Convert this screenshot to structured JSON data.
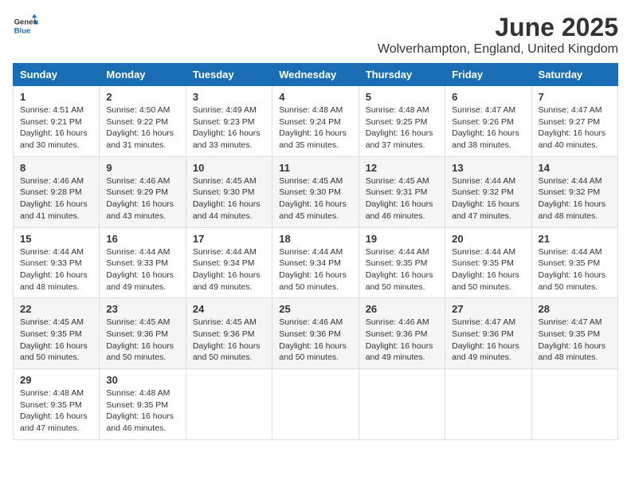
{
  "logo": {
    "general": "General",
    "blue": "Blue"
  },
  "header": {
    "month": "June 2025",
    "location": "Wolverhampton, England, United Kingdom"
  },
  "weekdays": [
    "Sunday",
    "Monday",
    "Tuesday",
    "Wednesday",
    "Thursday",
    "Friday",
    "Saturday"
  ],
  "weeks": [
    [
      {
        "day": "1",
        "sunrise": "4:51 AM",
        "sunset": "9:21 PM",
        "daylight": "16 hours and 30 minutes."
      },
      {
        "day": "2",
        "sunrise": "4:50 AM",
        "sunset": "9:22 PM",
        "daylight": "16 hours and 31 minutes."
      },
      {
        "day": "3",
        "sunrise": "4:49 AM",
        "sunset": "9:23 PM",
        "daylight": "16 hours and 33 minutes."
      },
      {
        "day": "4",
        "sunrise": "4:48 AM",
        "sunset": "9:24 PM",
        "daylight": "16 hours and 35 minutes."
      },
      {
        "day": "5",
        "sunrise": "4:48 AM",
        "sunset": "9:25 PM",
        "daylight": "16 hours and 37 minutes."
      },
      {
        "day": "6",
        "sunrise": "4:47 AM",
        "sunset": "9:26 PM",
        "daylight": "16 hours and 38 minutes."
      },
      {
        "day": "7",
        "sunrise": "4:47 AM",
        "sunset": "9:27 PM",
        "daylight": "16 hours and 40 minutes."
      }
    ],
    [
      {
        "day": "8",
        "sunrise": "4:46 AM",
        "sunset": "9:28 PM",
        "daylight": "16 hours and 41 minutes."
      },
      {
        "day": "9",
        "sunrise": "4:46 AM",
        "sunset": "9:29 PM",
        "daylight": "16 hours and 43 minutes."
      },
      {
        "day": "10",
        "sunrise": "4:45 AM",
        "sunset": "9:30 PM",
        "daylight": "16 hours and 44 minutes."
      },
      {
        "day": "11",
        "sunrise": "4:45 AM",
        "sunset": "9:30 PM",
        "daylight": "16 hours and 45 minutes."
      },
      {
        "day": "12",
        "sunrise": "4:45 AM",
        "sunset": "9:31 PM",
        "daylight": "16 hours and 46 minutes."
      },
      {
        "day": "13",
        "sunrise": "4:44 AM",
        "sunset": "9:32 PM",
        "daylight": "16 hours and 47 minutes."
      },
      {
        "day": "14",
        "sunrise": "4:44 AM",
        "sunset": "9:32 PM",
        "daylight": "16 hours and 48 minutes."
      }
    ],
    [
      {
        "day": "15",
        "sunrise": "4:44 AM",
        "sunset": "9:33 PM",
        "daylight": "16 hours and 48 minutes."
      },
      {
        "day": "16",
        "sunrise": "4:44 AM",
        "sunset": "9:33 PM",
        "daylight": "16 hours and 49 minutes."
      },
      {
        "day": "17",
        "sunrise": "4:44 AM",
        "sunset": "9:34 PM",
        "daylight": "16 hours and 49 minutes."
      },
      {
        "day": "18",
        "sunrise": "4:44 AM",
        "sunset": "9:34 PM",
        "daylight": "16 hours and 50 minutes."
      },
      {
        "day": "19",
        "sunrise": "4:44 AM",
        "sunset": "9:35 PM",
        "daylight": "16 hours and 50 minutes."
      },
      {
        "day": "20",
        "sunrise": "4:44 AM",
        "sunset": "9:35 PM",
        "daylight": "16 hours and 50 minutes."
      },
      {
        "day": "21",
        "sunrise": "4:44 AM",
        "sunset": "9:35 PM",
        "daylight": "16 hours and 50 minutes."
      }
    ],
    [
      {
        "day": "22",
        "sunrise": "4:45 AM",
        "sunset": "9:35 PM",
        "daylight": "16 hours and 50 minutes."
      },
      {
        "day": "23",
        "sunrise": "4:45 AM",
        "sunset": "9:36 PM",
        "daylight": "16 hours and 50 minutes."
      },
      {
        "day": "24",
        "sunrise": "4:45 AM",
        "sunset": "9:36 PM",
        "daylight": "16 hours and 50 minutes."
      },
      {
        "day": "25",
        "sunrise": "4:46 AM",
        "sunset": "9:36 PM",
        "daylight": "16 hours and 50 minutes."
      },
      {
        "day": "26",
        "sunrise": "4:46 AM",
        "sunset": "9:36 PM",
        "daylight": "16 hours and 49 minutes."
      },
      {
        "day": "27",
        "sunrise": "4:47 AM",
        "sunset": "9:36 PM",
        "daylight": "16 hours and 49 minutes."
      },
      {
        "day": "28",
        "sunrise": "4:47 AM",
        "sunset": "9:35 PM",
        "daylight": "16 hours and 48 minutes."
      }
    ],
    [
      {
        "day": "29",
        "sunrise": "4:48 AM",
        "sunset": "9:35 PM",
        "daylight": "16 hours and 47 minutes."
      },
      {
        "day": "30",
        "sunrise": "4:48 AM",
        "sunset": "9:35 PM",
        "daylight": "16 hours and 46 minutes."
      },
      null,
      null,
      null,
      null,
      null
    ]
  ]
}
